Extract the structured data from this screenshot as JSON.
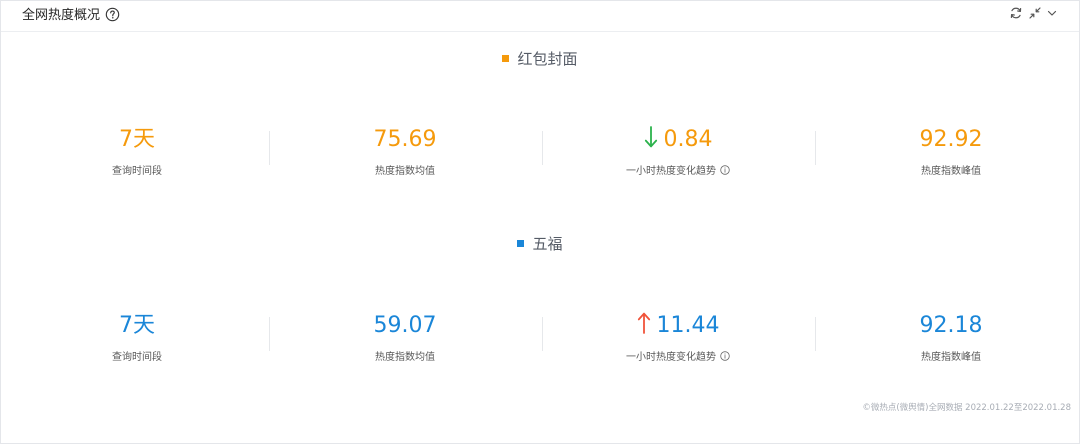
{
  "header": {
    "title": "全网热度概况"
  },
  "colors": {
    "orange": "#f59a0c",
    "blue": "#1a86d8",
    "green": "#2bb24c",
    "red": "#f0533a"
  },
  "sections": [
    {
      "title": "红包封面",
      "stats": [
        {
          "value": "7天",
          "label": "查询时间段"
        },
        {
          "value": "75.69",
          "label": "热度指数均值"
        },
        {
          "value": "0.84",
          "label": "一小时热度变化趋势",
          "trend": "down"
        },
        {
          "value": "92.92",
          "label": "热度指数峰值"
        }
      ]
    },
    {
      "title": "五福",
      "stats": [
        {
          "value": "7天",
          "label": "查询时间段"
        },
        {
          "value": "59.07",
          "label": "热度指数均值"
        },
        {
          "value": "11.44",
          "label": "一小时热度变化趋势",
          "trend": "up"
        },
        {
          "value": "92.18",
          "label": "热度指数峰值"
        }
      ]
    }
  ],
  "footer": "©微热点(微舆情)全网数据 2022.01.22至2022.01.28"
}
